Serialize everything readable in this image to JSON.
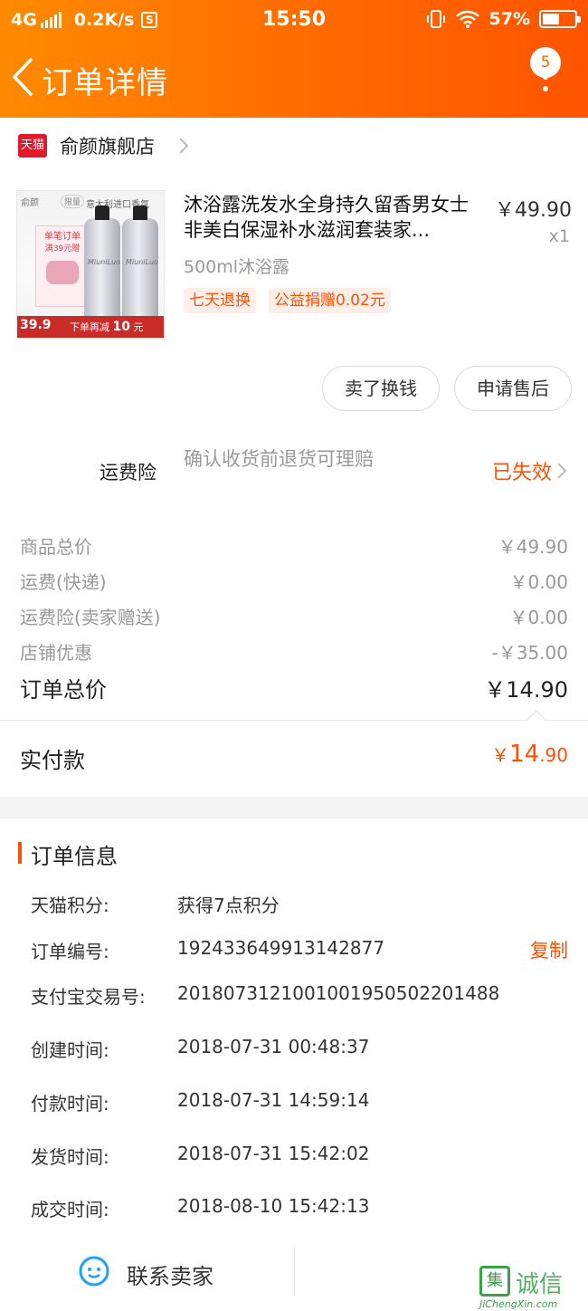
{
  "status_bar": {
    "network": "4G",
    "speed": "0.2K/s",
    "s_icon": "S",
    "time": "15:50",
    "battery": "57%",
    "battery_level": 0.57
  },
  "nav": {
    "title": "订单详情",
    "badge_count": "5",
    "icons": [
      "back-chevron-icon",
      "more-vertical-icon"
    ]
  },
  "store": {
    "logo_text": "天猫",
    "name": "俞颜旗舰店"
  },
  "product": {
    "image": {
      "brand": "俞颜",
      "tag": "限量",
      "top_text": "意大利进口香氛",
      "card_line1": "单笔订单",
      "card_line2": "满39元赠",
      "bottle_label": "MiuniLuo",
      "price": "39.9",
      "promo_prefix": "下单再减",
      "promo_amount": "10",
      "promo_unit": "元"
    },
    "title": "沐浴露洗发水全身持久留香男女士非美白保湿补水滋润套装家...",
    "price": "￥49.90",
    "quantity": "x1",
    "variant": "500ml沐浴露",
    "tags": [
      "七天退换",
      "公益捐赠0.02元"
    ]
  },
  "actions": {
    "sell_label": "卖了换钱",
    "after_sale_label": "申请售后"
  },
  "insurance": {
    "label": "运费险",
    "description": "确认收货前退货可理赔",
    "status": "已失效"
  },
  "costs": [
    {
      "label": "商品总价",
      "value": "￥49.90"
    },
    {
      "label": "运费(快递)",
      "value": "￥0.00"
    },
    {
      "label": "运费险(卖家赠送)",
      "value": "￥0.00"
    },
    {
      "label": "店铺优惠",
      "value": "-￥35.00"
    }
  ],
  "order_total": {
    "label": "订单总价",
    "value": "￥14.90"
  },
  "paid": {
    "label": "实付款",
    "currency": "￥",
    "integer": "14",
    "decimal": ".90"
  },
  "order_info": {
    "title": "订单信息",
    "rows": [
      {
        "label": "天猫积分:",
        "value": "获得7点积分"
      },
      {
        "label": "订单编号:",
        "value": "192433649913142877"
      },
      {
        "label": "支付宝交易号:",
        "value": "2018073121001001950502201488"
      },
      {
        "label": "创建时间:",
        "value": "2018-07-31 00:48:37"
      },
      {
        "label": "付款时间:",
        "value": "2018-07-31 14:59:14"
      },
      {
        "label": "发货时间:",
        "value": "2018-07-31 15:42:02"
      },
      {
        "label": "成交时间:",
        "value": "2018-08-10 15:42:13"
      }
    ],
    "copy_label": "复制"
  },
  "bottom": {
    "contact_label": "联系卖家"
  },
  "watermark": {
    "logo": "集",
    "text": "诚信",
    "url": "JiChengXin.com"
  },
  "colors": {
    "header_gradient": [
      "#ff8a00",
      "#ff5400"
    ],
    "accent": "#ff5000",
    "tmall_red": "#e5172b"
  }
}
